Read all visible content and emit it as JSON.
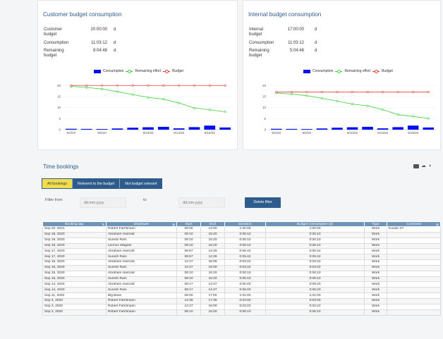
{
  "customer": {
    "title": "Customer budget consumption",
    "rows": [
      {
        "label": "Customer budget",
        "value": "20:00:00",
        "unit": "d"
      },
      {
        "label": "Consumption",
        "value": "11:03:12",
        "unit": "d"
      },
      {
        "label": "Remaining budget",
        "value": "8:04:48",
        "unit": "d"
      }
    ]
  },
  "internal": {
    "title": "Internal budget consumption",
    "rows": [
      {
        "label": "Internal budget",
        "value": "17:00:00",
        "unit": "d"
      },
      {
        "label": "Consumption",
        "value": "11:03:12",
        "unit": "d"
      },
      {
        "label": "Remaining budget",
        "value": "5:04:48",
        "unit": "d"
      }
    ]
  },
  "legend": {
    "consumption": "Consumption",
    "remaining": "Remaining effort",
    "budget": "Budget"
  },
  "colors": {
    "consumption": "#0010ee",
    "remaining": "#3ad13a",
    "budget": "#e03b3b",
    "accent": "#2d5b8c",
    "active_tab": "#f1de4e"
  },
  "chart_data": [
    {
      "type": "line",
      "x_tick_labels": [
        "9/2/20",
        "9/6/20",
        "9/10/20",
        "9/14/20",
        "9/18/20"
      ],
      "y_ticks": [
        0,
        5,
        10,
        15,
        20
      ],
      "ylim": [
        0,
        22
      ],
      "series": [
        {
          "name": "Consumption",
          "type": "bar",
          "values": [
            0.4,
            0.35,
            0.3,
            0.55,
            0.9,
            1.1,
            1.3,
            0.6,
            1.15,
            1.85,
            1.0
          ]
        },
        {
          "name": "Remaining effort",
          "type": "line",
          "values": [
            19.6,
            19.1,
            18.4,
            17.2,
            15.9,
            14.6,
            13.8,
            12.1,
            9.8,
            9.0,
            8.1
          ]
        },
        {
          "name": "Budget",
          "type": "line",
          "values": [
            20,
            20,
            20,
            20,
            20,
            20,
            20,
            20,
            20,
            20,
            20
          ]
        }
      ]
    },
    {
      "type": "line",
      "x_tick_labels": [
        "9/2/20",
        "9/6/20",
        "9/10/20",
        "9/14/20",
        "9/18/20"
      ],
      "y_ticks": [
        0,
        5,
        10,
        15,
        20
      ],
      "ylim": [
        0,
        22
      ],
      "series": [
        {
          "name": "Consumption",
          "type": "bar",
          "values": [
            0.4,
            0.35,
            0.3,
            0.55,
            0.9,
            1.1,
            1.3,
            0.6,
            1.15,
            1.85,
            1.0
          ]
        },
        {
          "name": "Remaining effort",
          "type": "line",
          "values": [
            16.6,
            16.1,
            15.4,
            14.2,
            12.9,
            11.6,
            10.8,
            9.1,
            6.8,
            6.0,
            5.1
          ]
        },
        {
          "name": "Budget",
          "type": "line",
          "values": [
            17,
            17,
            17,
            17,
            17,
            17,
            17,
            17,
            17,
            17,
            17
          ]
        }
      ]
    }
  ],
  "bookings": {
    "title": "Time bookings",
    "icons": [
      "list-icon",
      "cloud-icon",
      "toggle-icon"
    ],
    "tabs": [
      {
        "label": "All bookings",
        "active": true
      },
      {
        "label": "Relevent to the budget",
        "active": false
      },
      {
        "label": "Not budget relevant",
        "active": false
      }
    ],
    "filter_from_label": "Filter from",
    "filter_to_label": "to",
    "date_placeholder": "dd.mm.yyyy",
    "delete_filter_label": "Delete filter",
    "columns": [
      "Booking day",
      "Employee",
      "Start",
      "End",
      "Duration",
      "Budget consumption (d)",
      "Type",
      "Comment"
    ],
    "rows": [
      [
        "Sep 20, 2021",
        "Robert Fahrtmann",
        "06:00",
        "14:00",
        "1:00:00",
        "1:00:00",
        "Work",
        "Kunde XY"
      ],
      [
        "Sep 18, 2020",
        "Abraham Harnold",
        "09:10",
        "15:20",
        "0:06:10",
        "0:06:10",
        "Work",
        ""
      ],
      [
        "Sep 18, 2020",
        "Suresh Ram",
        "09:10",
        "15:20",
        "0:06:10",
        "0:06:10",
        "Work",
        ""
      ],
      [
        "Sep 18, 2020",
        "Lennox Wagner",
        "09:10",
        "15:20",
        "0:06:10",
        "0:06:10",
        "Work",
        ""
      ],
      [
        "Sep 17, 2020",
        "Abraham Harnold",
        "08:57",
        "14:39",
        "0:05:42",
        "0:05:42",
        "Work",
        ""
      ],
      [
        "Sep 17, 2020",
        "Suresh Ram",
        "08:57",
        "14:39",
        "0:05:42",
        "0:05:42",
        "Work",
        ""
      ],
      [
        "Sep 16, 2020",
        "Abraham Harnold",
        "12:47",
        "16:09",
        "0:03:22",
        "0:03:22",
        "Work",
        ""
      ],
      [
        "Sep 16, 2020",
        "Suresh Ram",
        "12:47",
        "16:09",
        "0:03:22",
        "0:03:22",
        "Work",
        ""
      ],
      [
        "Sep 15, 2020",
        "Abraham Harnold",
        "09:10",
        "15:20",
        "0:06:10",
        "0:06:10",
        "Work",
        ""
      ],
      [
        "Sep 15, 2020",
        "Suresh Ram",
        "09:10",
        "15:20",
        "0:06:10",
        "0:06:10",
        "Work",
        ""
      ],
      [
        "Sep 14, 2020",
        "Abraham Harnold",
        "08:17",
        "14:37",
        "0:06:20",
        "0:06:20",
        "Work",
        ""
      ],
      [
        "Sep 14, 2020",
        "Suresh Ram",
        "08:17",
        "14:37",
        "0:06:20",
        "0:06:20",
        "Work",
        ""
      ],
      [
        "Sep 11, 2020",
        "Big Boss",
        "08:00",
        "17:00",
        "1:01:00",
        "1:01:00",
        "Work",
        ""
      ],
      [
        "Sep 4, 2020",
        "Robert Fahrtmann",
        "14:39",
        "17:39",
        "0:03:00",
        "0:03:00",
        "Work",
        ""
      ],
      [
        "Sep 3, 2020",
        "Robert Fahrtmann",
        "12:47",
        "16:09",
        "0:03:22",
        "0:03:22",
        "Work",
        ""
      ],
      [
        "Sep 2, 2020",
        "Robert Fahrtmann",
        "09:10",
        "15:20",
        "0:06:10",
        "0:06:10",
        "Work",
        ""
      ]
    ]
  }
}
